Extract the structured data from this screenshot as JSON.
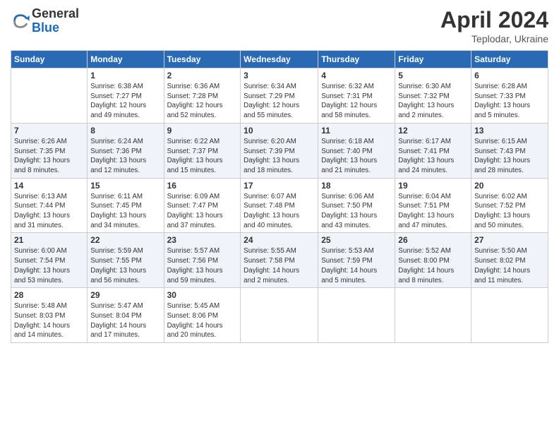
{
  "header": {
    "logo_general": "General",
    "logo_blue": "Blue",
    "month_title": "April 2024",
    "subtitle": "Teplodar, Ukraine"
  },
  "weekdays": [
    "Sunday",
    "Monday",
    "Tuesday",
    "Wednesday",
    "Thursday",
    "Friday",
    "Saturday"
  ],
  "weeks": [
    [
      {
        "day": "",
        "info": ""
      },
      {
        "day": "1",
        "info": "Sunrise: 6:38 AM\nSunset: 7:27 PM\nDaylight: 12 hours\nand 49 minutes."
      },
      {
        "day": "2",
        "info": "Sunrise: 6:36 AM\nSunset: 7:28 PM\nDaylight: 12 hours\nand 52 minutes."
      },
      {
        "day": "3",
        "info": "Sunrise: 6:34 AM\nSunset: 7:29 PM\nDaylight: 12 hours\nand 55 minutes."
      },
      {
        "day": "4",
        "info": "Sunrise: 6:32 AM\nSunset: 7:31 PM\nDaylight: 12 hours\nand 58 minutes."
      },
      {
        "day": "5",
        "info": "Sunrise: 6:30 AM\nSunset: 7:32 PM\nDaylight: 13 hours\nand 2 minutes."
      },
      {
        "day": "6",
        "info": "Sunrise: 6:28 AM\nSunset: 7:33 PM\nDaylight: 13 hours\nand 5 minutes."
      }
    ],
    [
      {
        "day": "7",
        "info": "Sunrise: 6:26 AM\nSunset: 7:35 PM\nDaylight: 13 hours\nand 8 minutes."
      },
      {
        "day": "8",
        "info": "Sunrise: 6:24 AM\nSunset: 7:36 PM\nDaylight: 13 hours\nand 12 minutes."
      },
      {
        "day": "9",
        "info": "Sunrise: 6:22 AM\nSunset: 7:37 PM\nDaylight: 13 hours\nand 15 minutes."
      },
      {
        "day": "10",
        "info": "Sunrise: 6:20 AM\nSunset: 7:39 PM\nDaylight: 13 hours\nand 18 minutes."
      },
      {
        "day": "11",
        "info": "Sunrise: 6:18 AM\nSunset: 7:40 PM\nDaylight: 13 hours\nand 21 minutes."
      },
      {
        "day": "12",
        "info": "Sunrise: 6:17 AM\nSunset: 7:41 PM\nDaylight: 13 hours\nand 24 minutes."
      },
      {
        "day": "13",
        "info": "Sunrise: 6:15 AM\nSunset: 7:43 PM\nDaylight: 13 hours\nand 28 minutes."
      }
    ],
    [
      {
        "day": "14",
        "info": "Sunrise: 6:13 AM\nSunset: 7:44 PM\nDaylight: 13 hours\nand 31 minutes."
      },
      {
        "day": "15",
        "info": "Sunrise: 6:11 AM\nSunset: 7:45 PM\nDaylight: 13 hours\nand 34 minutes."
      },
      {
        "day": "16",
        "info": "Sunrise: 6:09 AM\nSunset: 7:47 PM\nDaylight: 13 hours\nand 37 minutes."
      },
      {
        "day": "17",
        "info": "Sunrise: 6:07 AM\nSunset: 7:48 PM\nDaylight: 13 hours\nand 40 minutes."
      },
      {
        "day": "18",
        "info": "Sunrise: 6:06 AM\nSunset: 7:50 PM\nDaylight: 13 hours\nand 43 minutes."
      },
      {
        "day": "19",
        "info": "Sunrise: 6:04 AM\nSunset: 7:51 PM\nDaylight: 13 hours\nand 47 minutes."
      },
      {
        "day": "20",
        "info": "Sunrise: 6:02 AM\nSunset: 7:52 PM\nDaylight: 13 hours\nand 50 minutes."
      }
    ],
    [
      {
        "day": "21",
        "info": "Sunrise: 6:00 AM\nSunset: 7:54 PM\nDaylight: 13 hours\nand 53 minutes."
      },
      {
        "day": "22",
        "info": "Sunrise: 5:59 AM\nSunset: 7:55 PM\nDaylight: 13 hours\nand 56 minutes."
      },
      {
        "day": "23",
        "info": "Sunrise: 5:57 AM\nSunset: 7:56 PM\nDaylight: 13 hours\nand 59 minutes."
      },
      {
        "day": "24",
        "info": "Sunrise: 5:55 AM\nSunset: 7:58 PM\nDaylight: 14 hours\nand 2 minutes."
      },
      {
        "day": "25",
        "info": "Sunrise: 5:53 AM\nSunset: 7:59 PM\nDaylight: 14 hours\nand 5 minutes."
      },
      {
        "day": "26",
        "info": "Sunrise: 5:52 AM\nSunset: 8:00 PM\nDaylight: 14 hours\nand 8 minutes."
      },
      {
        "day": "27",
        "info": "Sunrise: 5:50 AM\nSunset: 8:02 PM\nDaylight: 14 hours\nand 11 minutes."
      }
    ],
    [
      {
        "day": "28",
        "info": "Sunrise: 5:48 AM\nSunset: 8:03 PM\nDaylight: 14 hours\nand 14 minutes."
      },
      {
        "day": "29",
        "info": "Sunrise: 5:47 AM\nSunset: 8:04 PM\nDaylight: 14 hours\nand 17 minutes."
      },
      {
        "day": "30",
        "info": "Sunrise: 5:45 AM\nSunset: 8:06 PM\nDaylight: 14 hours\nand 20 minutes."
      },
      {
        "day": "",
        "info": ""
      },
      {
        "day": "",
        "info": ""
      },
      {
        "day": "",
        "info": ""
      },
      {
        "day": "",
        "info": ""
      }
    ]
  ]
}
